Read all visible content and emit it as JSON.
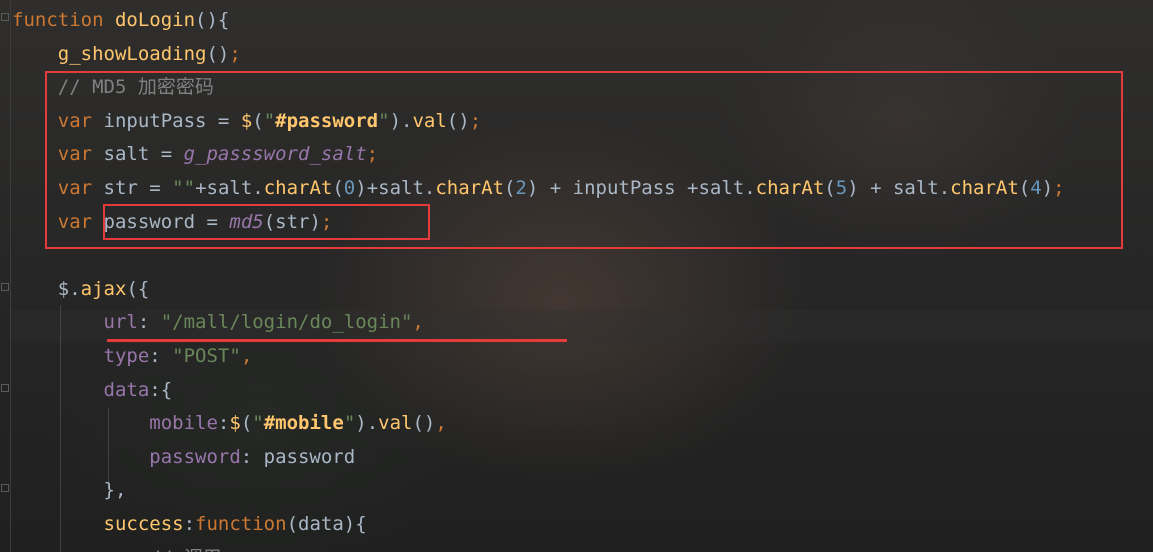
{
  "editor": {
    "lines": [
      {
        "tokens": [
          {
            "t": "function",
            "c": "kw"
          },
          {
            "t": " ",
            "c": "plain"
          },
          {
            "t": "doLogin",
            "c": "fn"
          },
          {
            "t": "(){",
            "c": "plain"
          }
        ]
      },
      {
        "tokens": [
          {
            "t": "    ",
            "c": "plain"
          },
          {
            "t": "g_showLoading",
            "c": "fn"
          },
          {
            "t": "()",
            "c": "plain"
          },
          {
            "t": ";",
            "c": "kw"
          }
        ]
      },
      {
        "tokens": [
          {
            "t": "    ",
            "c": "plain"
          },
          {
            "t": "// MD5 加密密码",
            "c": "cm"
          }
        ]
      },
      {
        "tokens": [
          {
            "t": "    ",
            "c": "plain"
          },
          {
            "t": "var",
            "c": "kw"
          },
          {
            "t": " inputPass = ",
            "c": "plain"
          },
          {
            "t": "$",
            "c": "fn"
          },
          {
            "t": "(",
            "c": "plain"
          },
          {
            "t": "\"",
            "c": "str"
          },
          {
            "t": "#password",
            "c": "sel"
          },
          {
            "t": "\"",
            "c": "str"
          },
          {
            "t": ").",
            "c": "plain"
          },
          {
            "t": "val",
            "c": "fn"
          },
          {
            "t": "()",
            "c": "plain"
          },
          {
            "t": ";",
            "c": "kw"
          }
        ]
      },
      {
        "tokens": [
          {
            "t": "    ",
            "c": "plain"
          },
          {
            "t": "var",
            "c": "kw"
          },
          {
            "t": " salt = ",
            "c": "plain"
          },
          {
            "t": "g_passsword_salt",
            "c": "gvar"
          },
          {
            "t": ";",
            "c": "kw"
          }
        ]
      },
      {
        "tokens": [
          {
            "t": "    ",
            "c": "plain"
          },
          {
            "t": "var",
            "c": "kw"
          },
          {
            "t": " str = ",
            "c": "plain"
          },
          {
            "t": "\"\"",
            "c": "str"
          },
          {
            "t": "+salt.",
            "c": "plain"
          },
          {
            "t": "charAt",
            "c": "fn"
          },
          {
            "t": "(",
            "c": "plain"
          },
          {
            "t": "0",
            "c": "num"
          },
          {
            "t": ")+salt.",
            "c": "plain"
          },
          {
            "t": "charAt",
            "c": "fn"
          },
          {
            "t": "(",
            "c": "plain"
          },
          {
            "t": "2",
            "c": "num"
          },
          {
            "t": ") + inputPass +salt.",
            "c": "plain"
          },
          {
            "t": "charAt",
            "c": "fn"
          },
          {
            "t": "(",
            "c": "plain"
          },
          {
            "t": "5",
            "c": "num"
          },
          {
            "t": ") + salt.",
            "c": "plain"
          },
          {
            "t": "charAt",
            "c": "fn"
          },
          {
            "t": "(",
            "c": "plain"
          },
          {
            "t": "4",
            "c": "num"
          },
          {
            "t": ")",
            "c": "plain"
          },
          {
            "t": ";",
            "c": "kw"
          }
        ]
      },
      {
        "tokens": [
          {
            "t": "    ",
            "c": "plain"
          },
          {
            "t": "var",
            "c": "kw"
          },
          {
            "t": " password = ",
            "c": "plain"
          },
          {
            "t": "md5",
            "c": "gfn"
          },
          {
            "t": "(str)",
            "c": "plain"
          },
          {
            "t": ";",
            "c": "kw"
          }
        ]
      },
      {
        "tokens": []
      },
      {
        "tokens": [
          {
            "t": "    ",
            "c": "plain"
          },
          {
            "t": "$",
            "c": "plain"
          },
          {
            "t": ".",
            "c": "plain"
          },
          {
            "t": "ajax",
            "c": "fn"
          },
          {
            "t": "({",
            "c": "plain"
          }
        ]
      },
      {
        "tokens": [
          {
            "t": "        ",
            "c": "plain"
          },
          {
            "t": "url",
            "c": "prop"
          },
          {
            "t": ": ",
            "c": "plain"
          },
          {
            "t": "\"/mall/login/do_login\"",
            "c": "str"
          },
          {
            "t": ",",
            "c": "kw"
          }
        ]
      },
      {
        "tokens": [
          {
            "t": "        ",
            "c": "plain"
          },
          {
            "t": "type",
            "c": "prop"
          },
          {
            "t": ": ",
            "c": "plain"
          },
          {
            "t": "\"POST\"",
            "c": "str"
          },
          {
            "t": ",",
            "c": "kw"
          }
        ]
      },
      {
        "tokens": [
          {
            "t": "        ",
            "c": "plain"
          },
          {
            "t": "data",
            "c": "prop"
          },
          {
            "t": ":{",
            "c": "plain"
          }
        ]
      },
      {
        "tokens": [
          {
            "t": "            ",
            "c": "plain"
          },
          {
            "t": "mobile",
            "c": "prop"
          },
          {
            "t": ":",
            "c": "plain"
          },
          {
            "t": "$",
            "c": "fn"
          },
          {
            "t": "(",
            "c": "plain"
          },
          {
            "t": "\"",
            "c": "str"
          },
          {
            "t": "#mobile",
            "c": "sel"
          },
          {
            "t": "\"",
            "c": "str"
          },
          {
            "t": ").",
            "c": "plain"
          },
          {
            "t": "val",
            "c": "fn"
          },
          {
            "t": "()",
            "c": "plain"
          },
          {
            "t": ",",
            "c": "kw"
          }
        ]
      },
      {
        "tokens": [
          {
            "t": "            ",
            "c": "plain"
          },
          {
            "t": "password",
            "c": "prop"
          },
          {
            "t": ": password",
            "c": "plain"
          }
        ]
      },
      {
        "tokens": [
          {
            "t": "        ",
            "c": "plain"
          },
          {
            "t": "},",
            "c": "plain"
          }
        ]
      },
      {
        "tokens": [
          {
            "t": "        ",
            "c": "plain"
          },
          {
            "t": "success",
            "c": "fn"
          },
          {
            "t": ":",
            "c": "plain"
          },
          {
            "t": "function",
            "c": "kw"
          },
          {
            "t": "(data){",
            "c": "plain"
          }
        ]
      },
      {
        "tokens": [
          {
            "t": "            ",
            "c": "plain"
          },
          {
            "t": "// 调用...",
            "c": "cm"
          }
        ]
      }
    ]
  }
}
